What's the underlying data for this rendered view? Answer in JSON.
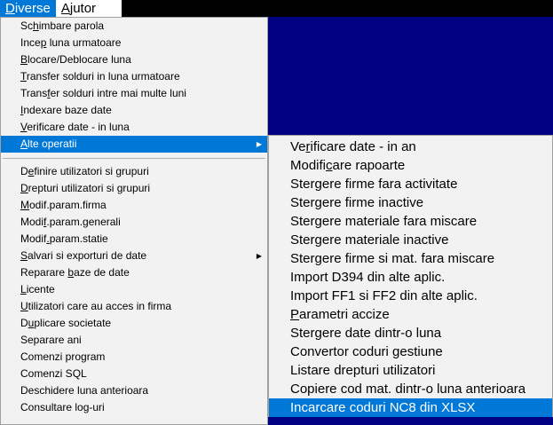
{
  "menubar": {
    "diverse": {
      "pre": "",
      "ul": "D",
      "post": "iverse"
    },
    "ajutor": {
      "pre": "",
      "ul": "A",
      "post": "jutor"
    }
  },
  "main_menu": {
    "group1": [
      {
        "pre": "Sc",
        "ul": "h",
        "post": "imbare parola"
      },
      {
        "pre": "Ince",
        "ul": "p",
        "post": " luna urmatoare"
      },
      {
        "pre": "",
        "ul": "B",
        "post": "locare/Deblocare luna"
      },
      {
        "pre": "",
        "ul": "T",
        "post": "ransfer solduri in luna urmatoare"
      },
      {
        "pre": "Trans",
        "ul": "f",
        "post": "er solduri intre mai multe luni"
      },
      {
        "pre": "",
        "ul": "I",
        "post": "ndexare baze date"
      },
      {
        "pre": "",
        "ul": "V",
        "post": "erificare date - in luna"
      },
      {
        "pre": "",
        "ul": "A",
        "post": "lte operatii",
        "submenu": true
      }
    ],
    "group2": [
      {
        "pre": "D",
        "ul": "e",
        "post": "finire utilizatori si grupuri"
      },
      {
        "pre": "",
        "ul": "D",
        "post": "repturi utilizatori si grupuri"
      },
      {
        "pre": "",
        "ul": "M",
        "post": "odif.param.firma"
      },
      {
        "pre": "Modi",
        "ul": "f",
        "post": ".param.generali"
      },
      {
        "pre": "Modif",
        "ul": ".",
        "post": "param.statie"
      },
      {
        "pre": "",
        "ul": "S",
        "post": "alvari si exporturi de date",
        "submenu": true
      },
      {
        "pre": "Reparare ",
        "ul": "b",
        "post": "aze de date"
      },
      {
        "pre": "",
        "ul": "L",
        "post": "icente"
      },
      {
        "pre": "",
        "ul": "U",
        "post": "tilizatori care au acces in firma"
      },
      {
        "pre": "D",
        "ul": "u",
        "post": "plicare societate"
      },
      {
        "pre": "Separare ani",
        "ul": "",
        "post": ""
      },
      {
        "pre": "Comenzi program",
        "ul": "",
        "post": ""
      },
      {
        "pre": "Comenzi SQL",
        "ul": "",
        "post": ""
      },
      {
        "pre": "Deschidere luna anterioara",
        "ul": "",
        "post": ""
      },
      {
        "pre": "Consultare log-uri",
        "ul": "",
        "post": ""
      }
    ]
  },
  "sub_menu": [
    {
      "pre": "Ve",
      "ul": "r",
      "post": "ificare date - in an"
    },
    {
      "pre": "Modifi",
      "ul": "c",
      "post": "are rapoarte"
    },
    {
      "pre": "Stergere firme fara activitate",
      "ul": "",
      "post": ""
    },
    {
      "pre": "Stergere firme inactive",
      "ul": "",
      "post": ""
    },
    {
      "pre": "Stergere materiale fara miscare",
      "ul": "",
      "post": ""
    },
    {
      "pre": "Stergere materiale inactive",
      "ul": "",
      "post": ""
    },
    {
      "pre": "Stergere firme si mat. fara miscare",
      "ul": "",
      "post": ""
    },
    {
      "pre": "Import D394 din alte aplic.",
      "ul": "",
      "post": ""
    },
    {
      "pre": "Import FF1 si FF2 din alte aplic.",
      "ul": "",
      "post": ""
    },
    {
      "pre": "",
      "ul": "P",
      "post": "arametri accize"
    },
    {
      "pre": "Stergere date dintr-o luna",
      "ul": "",
      "post": ""
    },
    {
      "pre": "Convertor coduri gestiune",
      "ul": "",
      "post": ""
    },
    {
      "pre": "Listare drepturi utilizatori",
      "ul": "",
      "post": ""
    },
    {
      "pre": "Copiere cod mat. dintr-o luna anterioara",
      "ul": "",
      "post": ""
    },
    {
      "pre": "Incarcare coduri NC8 din XLSX",
      "ul": "",
      "post": ""
    }
  ],
  "colors": {
    "highlight": "#0078d7",
    "desktop": "#000080",
    "menu_bg": "#f2f2f2"
  }
}
